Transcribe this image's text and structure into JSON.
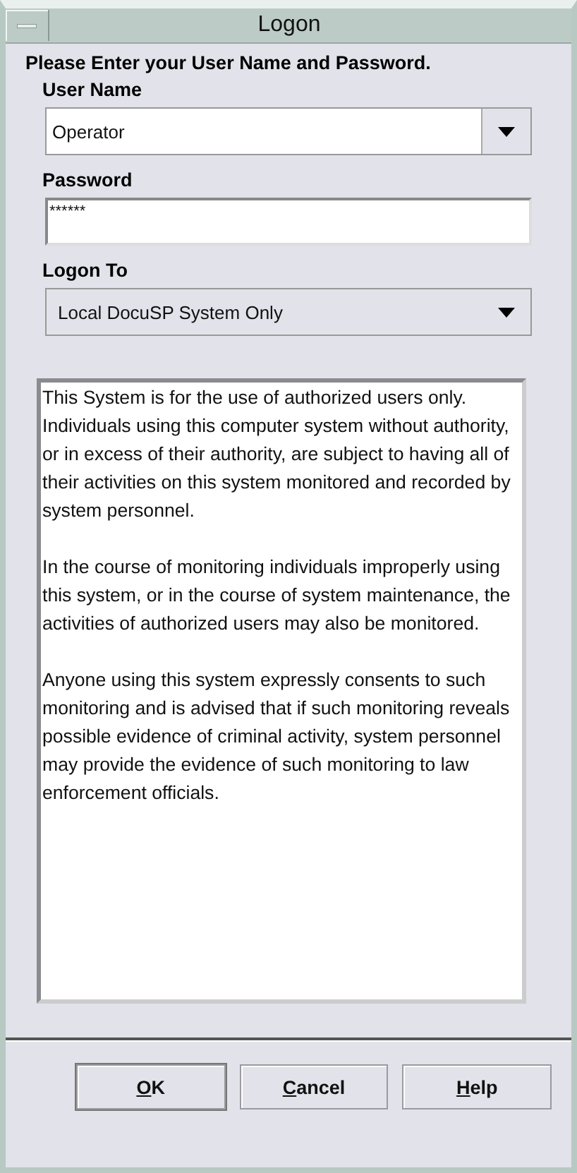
{
  "window": {
    "title": "Logon"
  },
  "instruction": "Please Enter your User Name and Password.",
  "user_name": {
    "label": "User Name",
    "value": "Operator"
  },
  "password": {
    "label": "Password",
    "value": "******"
  },
  "logon_to": {
    "label": "Logon To",
    "value": "Local DocuSP System Only"
  },
  "notice": [
    "This System is for the use of authorized users only. Individuals using this computer system without authority, or in excess of their authority, are subject to having all of their activities on this system monitored and recorded by system personnel.",
    "In the course of monitoring individuals improperly using this system, or in the course of system maintenance, the activities of authorized users may also be monitored.",
    "Anyone using this system expressly consents to such monitoring and is advised that if such monitoring reveals possible evidence of criminal activity, system personnel may provide the evidence of such monitoring to law enforcement officials."
  ],
  "buttons": [
    {
      "label": "OK",
      "underline_first": true,
      "default": true
    },
    {
      "label": "Cancel",
      "underline_first": true,
      "default": false
    },
    {
      "label": "Help",
      "underline_first": true,
      "default": false
    }
  ]
}
